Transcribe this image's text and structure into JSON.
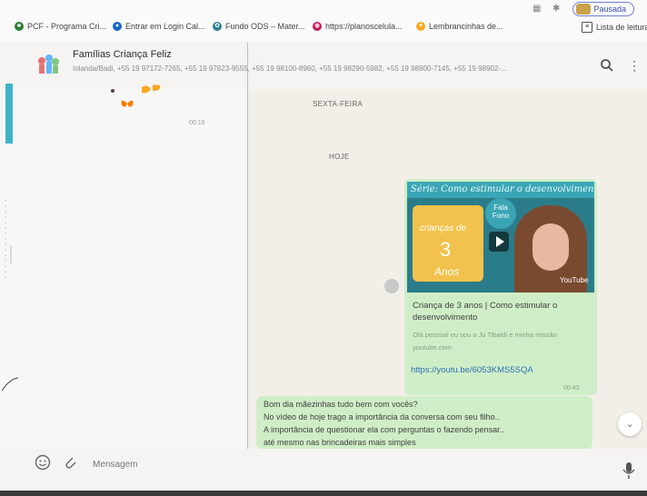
{
  "bookmarks": [
    {
      "label": "PCF - Programa Cri...",
      "icon": "pcf-icon",
      "color": "#2e7d32"
    },
    {
      "label": "Entrar em Login Cal...",
      "icon": "globe-icon",
      "color": "#1565c0"
    },
    {
      "label": "Fundo ODS – Mater...",
      "icon": "leaf-icon",
      "color": "#2e7d96"
    },
    {
      "label": "https://planoscelula...",
      "icon": "site-icon",
      "color": "#c2185b"
    },
    {
      "label": "Lembrancinhas de...",
      "icon": "bulb-icon",
      "color": "#f9a825"
    },
    {
      "label": "Lista de leitura",
      "icon": "reading-list-icon",
      "color": "#333333"
    }
  ],
  "browser": {
    "profile_status": "Pausada"
  },
  "chat": {
    "name": "Famílias Criança Feliz",
    "members": "Iolanda/Badi, +55 19 97172-7265, +55 19 97823-9555, +55 19 98100-8960, +55 19 98290-5982, +55 19 98900-7145, +55 19 98902-...",
    "left_time": "00:16",
    "day_label_1": "SEXTA-FEIRA",
    "day_label_2": "HOJE"
  },
  "video": {
    "banner": "Série: Como estimular o desenvolvimento",
    "card_text": "crianças de",
    "card_age": "3",
    "card_unit": "Anos",
    "badge": "Fala Fono",
    "logo": "YouTube",
    "title": "Criança de 3 anos | Como estimular o desenvolvimento",
    "description": "Olá pessoal eu sou a Ju Tibaldi e minha missão",
    "site": "youtube.com",
    "link": "https://youtu.be/6053KMS5SQA",
    "time": "00:43"
  },
  "message": {
    "lines": [
      "Bom dia mãezinhas tudo bem com vocês?",
      "No vídeo de hoje trago a importância da conversa com seu filho..",
      "A importância de questionar ela com perguntas o fazendo pensar..",
      "até mesmo nas brincadeiras mais simples"
    ]
  },
  "composer": {
    "placeholder": "Mensagem"
  },
  "colors": {
    "bubble": "#cfeec7",
    "accent": "#3db4c8",
    "link": "#2f6fb4"
  }
}
